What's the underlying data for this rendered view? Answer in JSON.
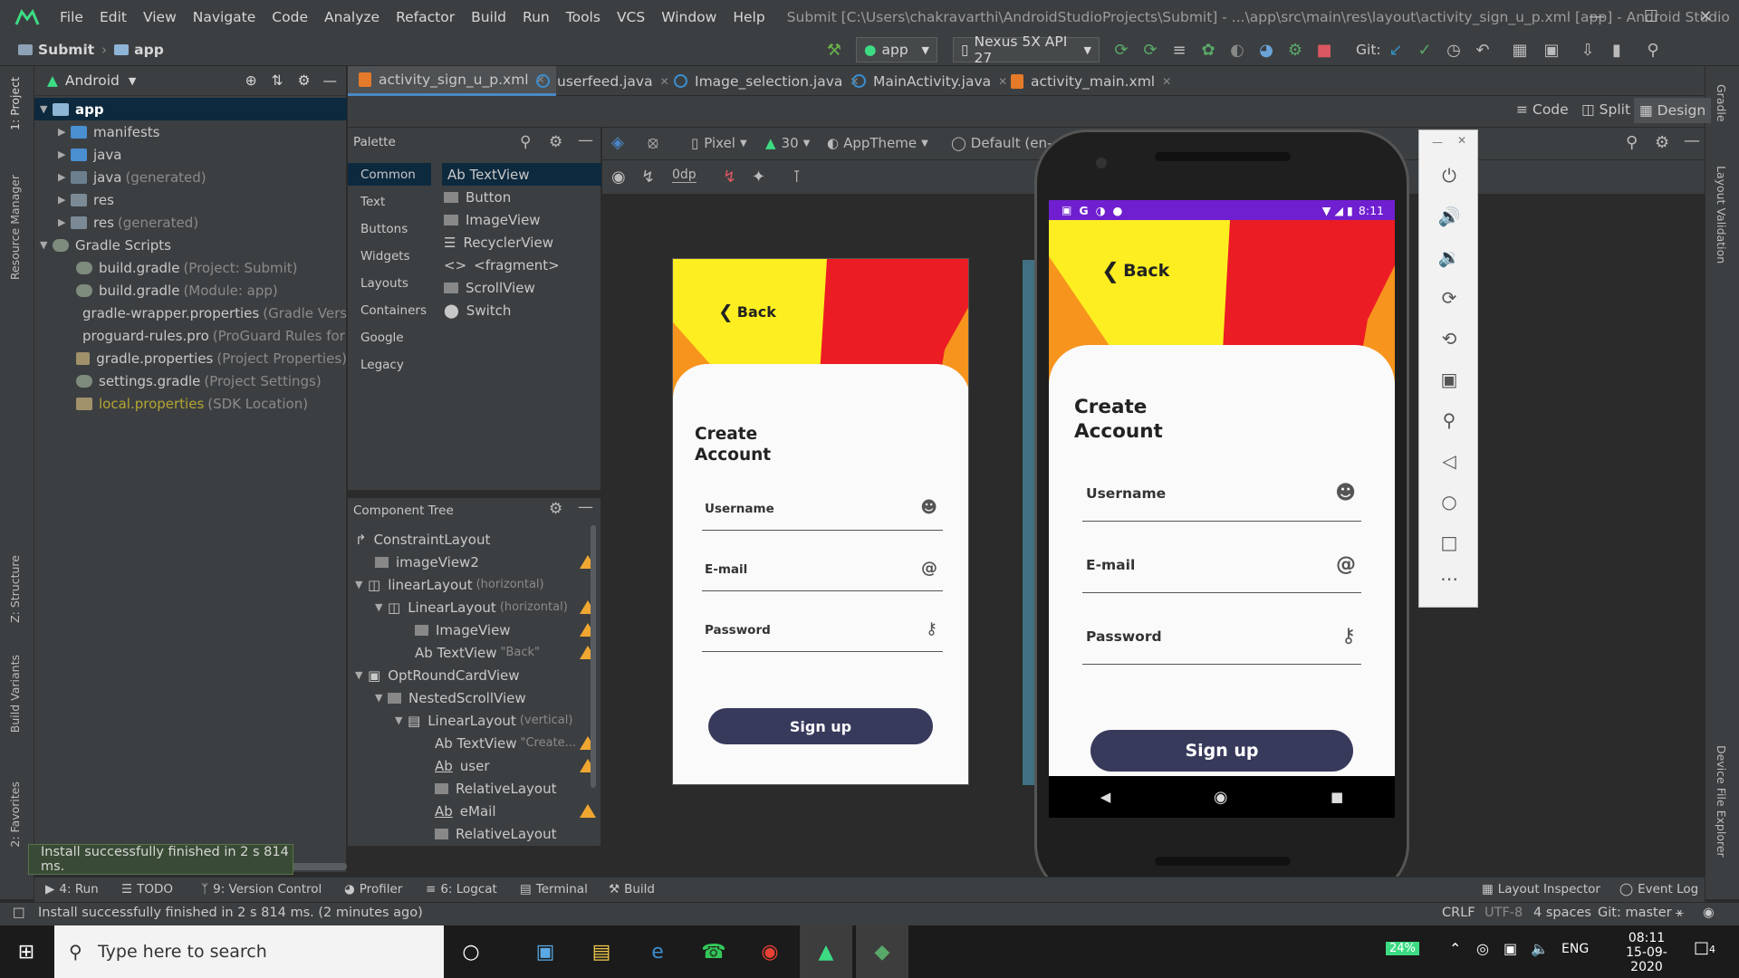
{
  "menubar": {
    "items": [
      "File",
      "Edit",
      "View",
      "Navigate",
      "Code",
      "Analyze",
      "Refactor",
      "Build",
      "Run",
      "Tools",
      "VCS",
      "Window",
      "Help"
    ],
    "title": "Submit [C:\\Users\\chakravarthi\\AndroidStudioProjects\\Submit] - ...\\app\\src\\main\\res\\layout\\activity_sign_u_p.xml [app] - Android Studio"
  },
  "navbar": {
    "breadcrumb": [
      "Submit",
      "app"
    ],
    "run_config": "app",
    "device": "Nexus 5X API 27",
    "git_label": "Git:"
  },
  "project_panel": {
    "view_mode": "Android",
    "tree": [
      {
        "label": "app",
        "hint": "",
        "expanded": true
      },
      {
        "label": "manifests",
        "hint": ""
      },
      {
        "label": "java",
        "hint": ""
      },
      {
        "label": "java",
        "hint": "(generated)"
      },
      {
        "label": "res",
        "hint": ""
      },
      {
        "label": "res",
        "hint": "(generated)"
      },
      {
        "label": "Gradle Scripts",
        "hint": "",
        "expanded": true
      },
      {
        "label": "build.gradle",
        "hint": "(Project: Submit)"
      },
      {
        "label": "build.gradle",
        "hint": "(Module: app)"
      },
      {
        "label": "gradle-wrapper.properties",
        "hint": "(Gradle Versio"
      },
      {
        "label": "proguard-rules.pro",
        "hint": "(ProGuard Rules for ap"
      },
      {
        "label": "gradle.properties",
        "hint": "(Project Properties)"
      },
      {
        "label": "settings.gradle",
        "hint": "(Project Settings)"
      },
      {
        "label": "local.properties",
        "hint": "(SDK Location)"
      }
    ]
  },
  "editor_tabs": [
    "activity_sign_u_p.xml",
    "userfeed.java",
    "Image_selection.java",
    "MainActivity.java",
    "activity_main.xml"
  ],
  "view_modes": [
    "Code",
    "Split",
    "Design"
  ],
  "palette": {
    "title": "Palette",
    "categories": [
      "Common",
      "Text",
      "Buttons",
      "Widgets",
      "Layouts",
      "Containers",
      "Google",
      "Legacy"
    ],
    "items": [
      "Ab TextView",
      "Button",
      "ImageView",
      "RecyclerView",
      "<fragment>",
      "ScrollView",
      "Switch"
    ]
  },
  "design_toolbar": {
    "device": "Pixel",
    "api": "30",
    "theme": "AppTheme",
    "locale": "Default (en-",
    "margin": "0dp"
  },
  "component_tree": {
    "title": "Component Tree",
    "rows": [
      {
        "label": "ConstraintLayout",
        "hint": "",
        "warn": false
      },
      {
        "label": "imageView2",
        "hint": "",
        "warn": true
      },
      {
        "label": "linearLayout",
        "hint": "(horizontal)",
        "warn": false
      },
      {
        "label": "LinearLayout",
        "hint": "(horizontal)",
        "warn": true
      },
      {
        "label": "ImageView",
        "hint": "",
        "warn": true
      },
      {
        "label": "Ab TextView",
        "hint": "\"Back\"",
        "warn": true
      },
      {
        "label": "OptRoundCardView",
        "hint": "",
        "warn": false
      },
      {
        "label": "NestedScrollView",
        "hint": "",
        "warn": false
      },
      {
        "label": "LinearLayout",
        "hint": "(vertical)",
        "warn": false
      },
      {
        "label": "Ab TextView",
        "hint": "\"Create...",
        "warn": true
      },
      {
        "label": "user",
        "hint": "",
        "warn": true
      },
      {
        "label": "RelativeLayout",
        "hint": "",
        "warn": false
      },
      {
        "label": "eMail",
        "hint": "",
        "warn": true
      },
      {
        "label": "RelativeLayout",
        "hint": "",
        "warn": false
      }
    ]
  },
  "form": {
    "back": "Back",
    "title_line1": "Create",
    "title_line2": "Account",
    "username": "Username",
    "email": "E-mail",
    "password": "Password",
    "signup": "Sign up"
  },
  "emulator": {
    "time": "8:11"
  },
  "bottom_tabs": [
    "4: Run",
    "TODO",
    "9: Version Control",
    "Profiler",
    "6: Logcat",
    "Terminal",
    "Build"
  ],
  "bottom_right_tabs": [
    "Layout Inspector",
    "Event Log"
  ],
  "toast": "Install successfully finished in 2 s 814 ms.",
  "status": {
    "message": "Install successfully finished in 2 s 814 ms. (2 minutes ago)",
    "line_sep": "CRLF",
    "encoding": "UTF-8",
    "indent": "4 spaces",
    "git": "Git: master"
  },
  "left_tool_tabs": [
    "1: Project",
    "Resource Manager",
    "Z: Structure",
    "Build Variants",
    "2: Favorites"
  ],
  "right_tool_tabs": [
    "Gradle",
    "Layout Validation",
    "Device File Explorer"
  ],
  "taskbar": {
    "search_placeholder": "Type here to search",
    "battery": "24%",
    "lang": "ENG",
    "time": "08:11",
    "date": "15-09-2020",
    "notifications": "4"
  },
  "colors": {
    "yellow": "#fdee21",
    "red": "#ec1c24",
    "orange": "#f7941d",
    "button": "#383a5c",
    "status_purple": "#6f1fcf"
  }
}
